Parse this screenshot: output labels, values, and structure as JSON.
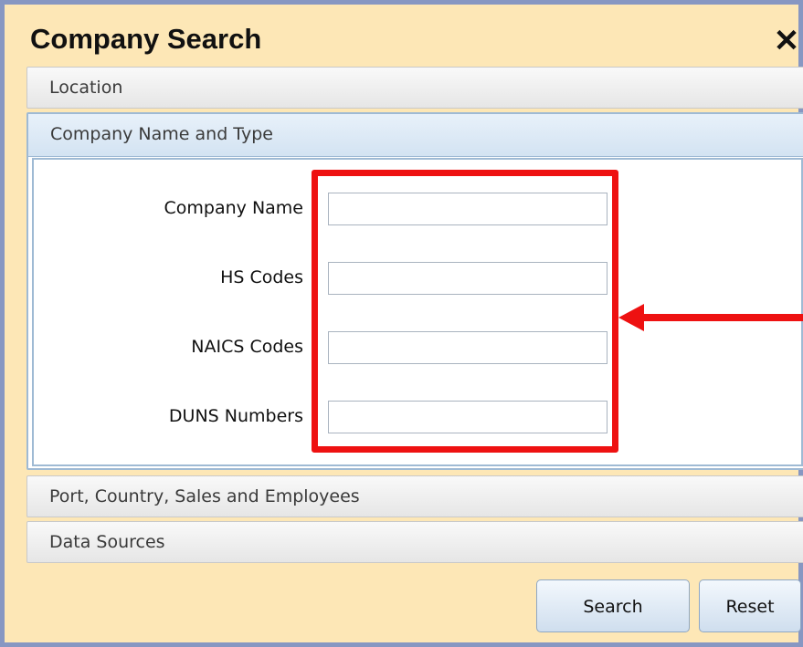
{
  "dialog": {
    "title": "Company Search",
    "close_symbol": "✕",
    "colors": {
      "background": "#fde7b6",
      "border": "#8797c2",
      "annotation": "#ee1111"
    }
  },
  "sections": {
    "location": {
      "label": "Location"
    },
    "company": {
      "label": "Company Name and Type",
      "fields": [
        {
          "label": "Company Name",
          "value": ""
        },
        {
          "label": "HS Codes",
          "value": ""
        },
        {
          "label": "NAICS Codes",
          "value": ""
        },
        {
          "label": "DUNS Numbers",
          "value": ""
        }
      ]
    },
    "port": {
      "label": "Port, Country, Sales and Employees"
    },
    "data_sources": {
      "label": "Data Sources"
    }
  },
  "buttons": {
    "search": "Search",
    "reset": "Reset"
  },
  "annotation": {
    "type": "red-highlight-box-with-left-arrow"
  }
}
